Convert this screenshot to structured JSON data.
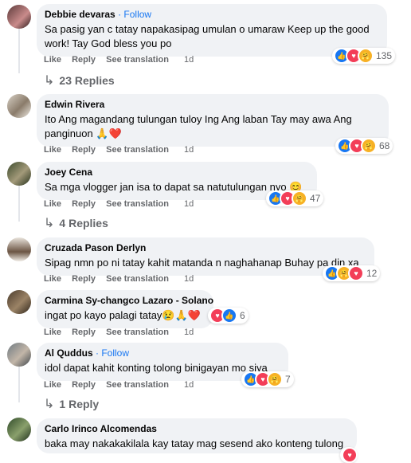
{
  "comments": [
    {
      "name": "Debbie devaras",
      "follow": "· Follow",
      "text": "Sa pasig yan c tatay napakasipag umulan o umaraw Keep up the good work! Tay God bless you po",
      "like": "Like",
      "reply": "Reply",
      "see_translation": "See translation",
      "time": "1d",
      "reaction_count": "135",
      "reactions": [
        "like-icon",
        "love-icon",
        "care-icon"
      ],
      "replies_label": "23 Replies"
    },
    {
      "name": "Edwin Rivera",
      "text": "Ito Ang magandang tulungan tuloy Ing Ang laban Tay may awa Ang panginuon 🙏❤️",
      "like": "Like",
      "reply": "Reply",
      "see_translation": "See translation",
      "time": "1d",
      "reaction_count": "68",
      "reactions": [
        "like-icon",
        "love-icon",
        "care-icon"
      ]
    },
    {
      "name": "Joey Cena",
      "text": "Sa mga vlogger jan isa to dapat sa natutulungan nyo 😊",
      "like": "Like",
      "reply": "Reply",
      "see_translation": "See translation",
      "time": "1d",
      "reaction_count": "47",
      "reactions": [
        "like-icon",
        "love-icon",
        "care-icon"
      ],
      "replies_label": "4 Replies"
    },
    {
      "name": "Cruzada Pason Derlyn",
      "text": "Sipag nmn po ni tatay kahit matanda n naghahanap Buhay pa din xa",
      "like": "Like",
      "reply": "Reply",
      "see_translation": "See translation",
      "time": "1d",
      "reaction_count": "12",
      "reactions": [
        "like-icon",
        "care-icon",
        "love-icon"
      ]
    },
    {
      "name": "Carmina Sy-changco Lazaro - Solano",
      "text": "ingat po kayo palagi tatay😢🙏❤️",
      "like": "Like",
      "reply": "Reply",
      "see_translation": "See translation",
      "time": "1d",
      "reaction_count": "6",
      "reactions": [
        "love-icon",
        "like-icon"
      ]
    },
    {
      "name": "Al Quddus",
      "follow": "· Follow",
      "text": "idol dapat kahit konting tolong binigayan mo siya",
      "like": "Like",
      "reply": "Reply",
      "see_translation": "See translation",
      "time": "1d",
      "reaction_count": "7",
      "reactions": [
        "like-icon",
        "love-icon",
        "care-icon"
      ],
      "replies_label": "1 Reply"
    },
    {
      "name": "Carlo Irinco Alcomendas",
      "text": "baka may nakakakilala kay tatay mag sesend ako konteng tulong",
      "reactions": [
        "love-icon"
      ]
    }
  ]
}
